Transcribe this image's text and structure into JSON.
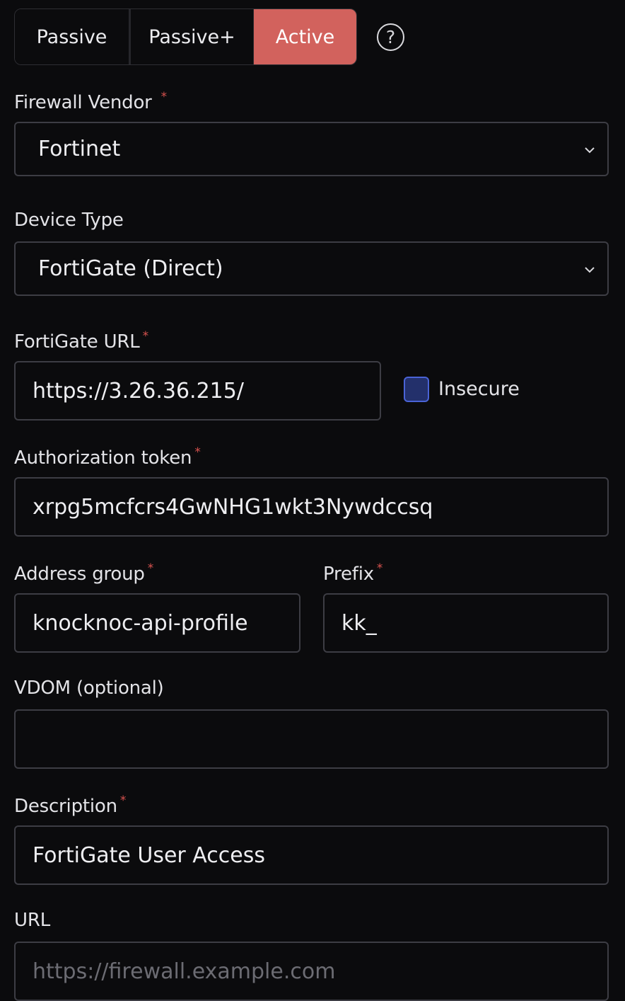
{
  "mode": {
    "options": [
      "Passive",
      "Passive+",
      "Active"
    ],
    "selected": "Active"
  },
  "help_icon_glyph": "?",
  "required_marker": "*",
  "vendor": {
    "label": "Firewall Vendor",
    "value": "Fortinet"
  },
  "device_type": {
    "label": "Device Type",
    "value": "FortiGate (Direct)"
  },
  "fortigate_url": {
    "label": "FortiGate URL",
    "value": "https://3.26.36.215/"
  },
  "insecure": {
    "label": "Insecure",
    "checked": false
  },
  "auth_token": {
    "label": "Authorization token",
    "value": "xrpg5mcfcrs4GwNHG1wkt3Nywdccsq"
  },
  "address_group": {
    "label": "Address group",
    "value": "knocknoc-api-profile"
  },
  "prefix": {
    "label": "Prefix",
    "value": "kk_"
  },
  "vdom": {
    "label": "VDOM (optional)",
    "value": ""
  },
  "description": {
    "label": "Description",
    "value": "FortiGate User Access"
  },
  "url": {
    "label": "URL",
    "value": "",
    "placeholder": "https://firewall.example.com"
  },
  "colors": {
    "background": "#0b0b0d",
    "active_mode": "#d2625d",
    "required": "#d9534f",
    "checkbox_fill": "#23306b",
    "checkbox_border": "#4a63d6"
  },
  "icons": [
    "help-circle-icon",
    "chevron-down-icon"
  ]
}
